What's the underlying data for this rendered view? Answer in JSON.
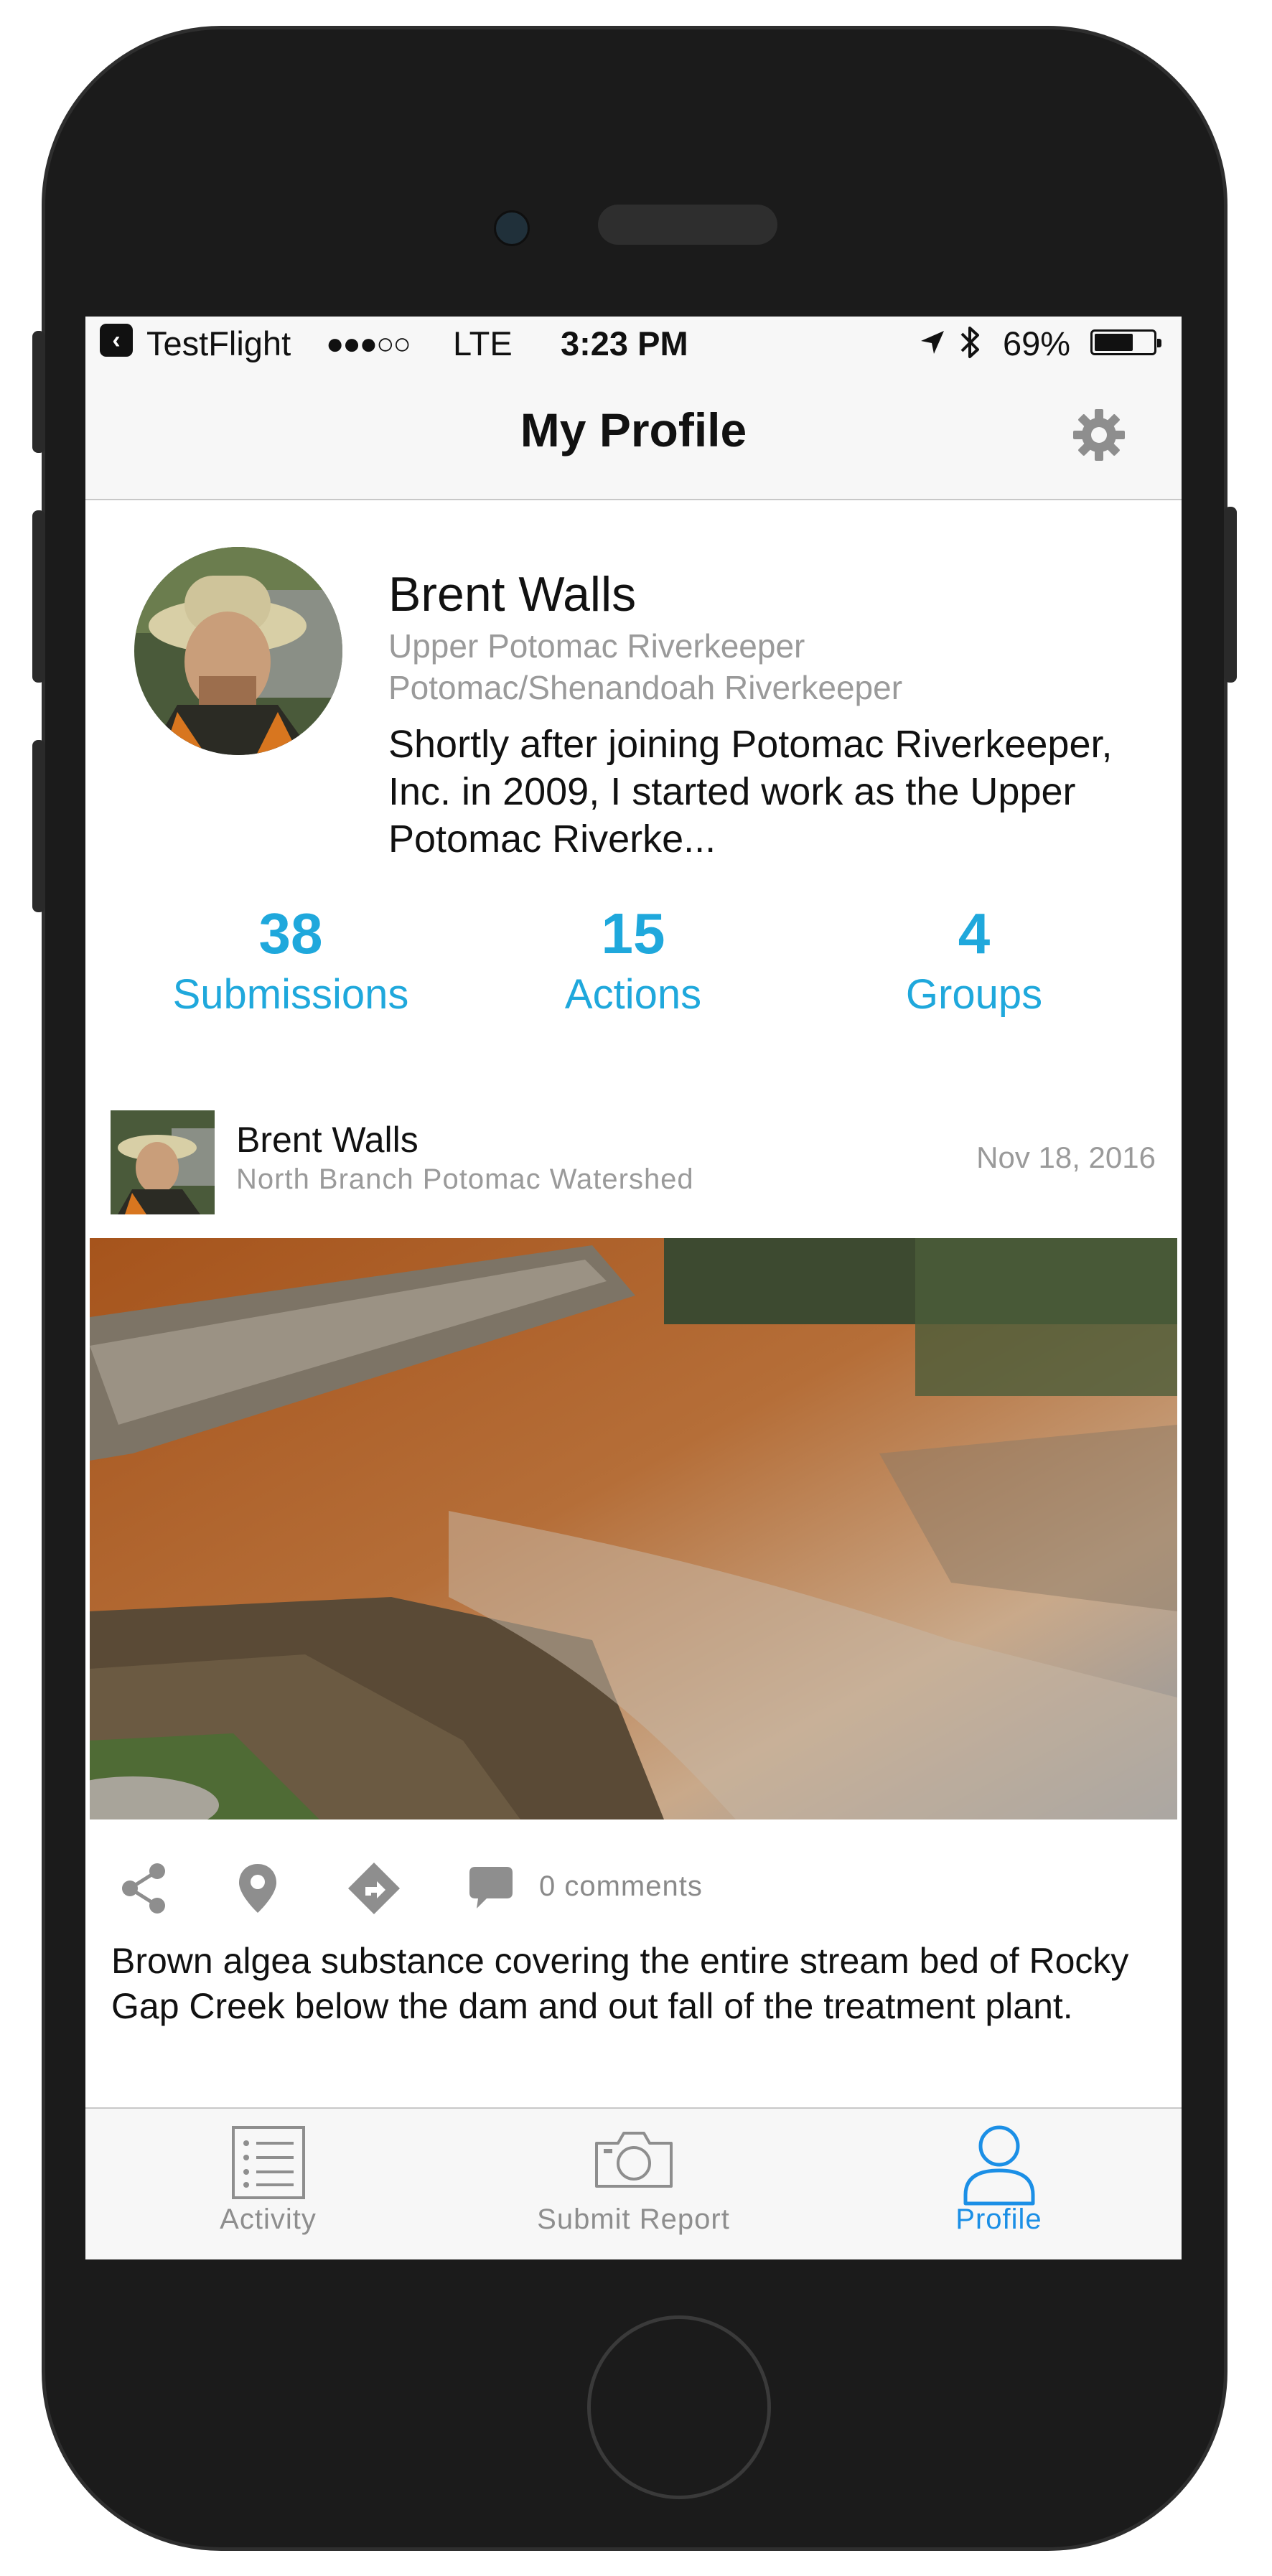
{
  "status_bar": {
    "back_app": "TestFlight",
    "signal": "●●●○○",
    "network": "LTE",
    "time": "3:23 PM",
    "battery": "69%",
    "battery_level": 0.69
  },
  "nav": {
    "title": "My Profile",
    "settings_icon": "gear-icon"
  },
  "profile": {
    "name": "Brent Walls",
    "affiliations": [
      "Upper Potomac Riverkeeper",
      "Potomac/Shenandoah Riverkeeper"
    ],
    "bio": "Shortly after joining Potomac Riverkeeper, Inc. in 2009, I started work as the Upper Potomac Riverke...",
    "stats": [
      {
        "value": "38",
        "label": "Submissions"
      },
      {
        "value": "15",
        "label": "Actions"
      },
      {
        "value": "4",
        "label": "Groups"
      }
    ]
  },
  "post": {
    "author": "Brent Walls",
    "watershed": "North Branch Potomac Watershed",
    "date": "Nov 18, 2016",
    "comments": "0 comments",
    "caption": "Brown algea substance covering the entire stream bed of Rocky Gap Creek below the dam and out fall of the treatment plant."
  },
  "tabs": [
    {
      "label": "Activity",
      "icon": "list-icon",
      "active": false
    },
    {
      "label": "Submit Report",
      "icon": "camera-icon",
      "active": false
    },
    {
      "label": "Profile",
      "icon": "person-icon",
      "active": true
    }
  ],
  "colors": {
    "accent": "#1fa8dc",
    "tab_active": "#1b8fe6",
    "tab_inactive": "#8e8e8e",
    "muted_text": "#9a9a9a"
  }
}
